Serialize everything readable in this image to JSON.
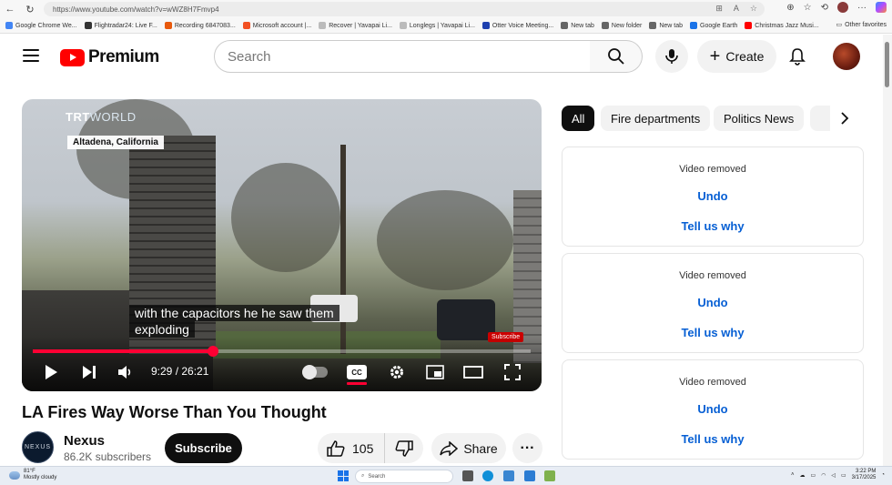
{
  "browser": {
    "url": "https://www.youtube.com/watch?v=wWZ8H7Fmvp4",
    "bookmarks": [
      {
        "label": "Google Chrome We...",
        "color": "#4285f4"
      },
      {
        "label": "Flightradar24: Live F...",
        "color": "#333333"
      },
      {
        "label": "Recording 6847083...",
        "color": "#e8590c"
      },
      {
        "label": "Microsoft account |...",
        "color": "#f25022"
      },
      {
        "label": "Recover | Yavapai Li...",
        "color": "#bbbbbb"
      },
      {
        "label": "Longlegs | Yavapai Li...",
        "color": "#bbbbbb"
      },
      {
        "label": "Otter Voice Meeting...",
        "color": "#1e40af"
      },
      {
        "label": "New tab",
        "color": "#666666"
      },
      {
        "label": "New folder",
        "color": "#666666"
      },
      {
        "label": "New tab",
        "color": "#666666"
      },
      {
        "label": "Google Earth",
        "color": "#1a73e8"
      },
      {
        "label": "Christmas Jazz Musi...",
        "color": "#ff0000"
      }
    ],
    "other_favorites": "Other favorites"
  },
  "header": {
    "logo_text": "Premium",
    "search_placeholder": "Search",
    "create_label": "Create"
  },
  "player": {
    "brand_overlay": "TRT",
    "brand_overlay_2": "WORLD",
    "location": "Altadena, California",
    "caption_line1": "with the capacitors he he saw them",
    "caption_line2": "exploding",
    "subscribe_badge": "Subscribe",
    "time": "9:29 / 26:21",
    "progress_fraction": 0.362,
    "cc_label": "CC"
  },
  "video": {
    "title": "LA Fires Way Worse Than You Thought",
    "channel_name": "Nexus",
    "channel_avatar_text": "NEXUS",
    "subscribers": "86.2K subscribers",
    "subscribe_label": "Subscribe",
    "likes": "105",
    "share_label": "Share"
  },
  "chips": [
    {
      "label": "All",
      "active": true
    },
    {
      "label": "Fire departments",
      "active": false
    },
    {
      "label": "Politics News",
      "active": false
    }
  ],
  "removed_cards": [
    {
      "text": "Video removed",
      "undo": "Undo",
      "tell": "Tell us why"
    },
    {
      "text": "Video removed",
      "undo": "Undo",
      "tell": "Tell us why"
    },
    {
      "text": "Video removed",
      "undo": "Undo",
      "tell": "Tell us why"
    }
  ],
  "taskbar": {
    "temperature": "81°F",
    "weather": "Mostly cloudy",
    "search_placeholder": "Search",
    "time": "3:22 PM",
    "date": "3/17/2025"
  },
  "colors": {
    "youtube_red": "#ff0000",
    "progress_red": "#ff0033",
    "link_blue": "#065fd4"
  }
}
